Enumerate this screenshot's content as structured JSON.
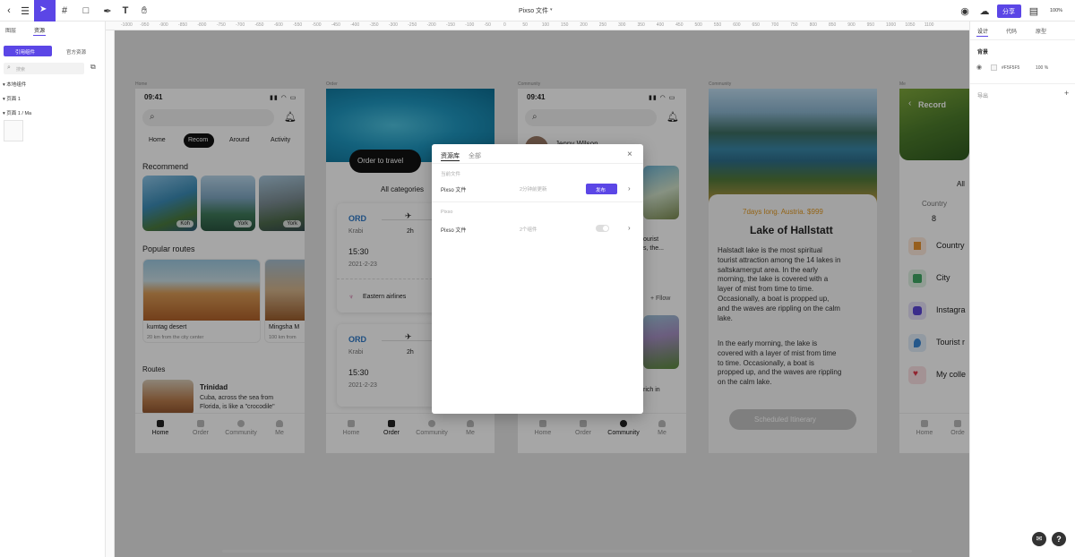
{
  "toolbar": {
    "doc_title": "Pixso 文件",
    "share_label": "分享",
    "zoom": "100%"
  },
  "left_panel": {
    "tabs": [
      "图层",
      "资源"
    ],
    "sub_tabs": [
      "引用组件",
      "官方资源"
    ],
    "search_placeholder": "搜索",
    "tree": [
      "本地组件",
      "页面 1",
      "页面 1 / Ma"
    ]
  },
  "right_panel": {
    "tabs": [
      "设计",
      "代码",
      "原型"
    ],
    "bg_label": "背景",
    "bg_hex": "#F5F5F5",
    "bg_opacity": "100 %",
    "export_label": "导出"
  },
  "ruler": {
    "ticks": [
      "-1000",
      "-950",
      "-900",
      "-850",
      "-800",
      "-750",
      "-700",
      "-650",
      "-600",
      "-550",
      "-500",
      "-450",
      "-400",
      "-350",
      "-300",
      "-250",
      "-200",
      "-150",
      "-100",
      "-50",
      "0",
      "50",
      "100",
      "150",
      "200",
      "250",
      "300",
      "350",
      "400",
      "450",
      "500",
      "550",
      "600",
      "650",
      "700",
      "750",
      "800",
      "850",
      "900",
      "950",
      "1000",
      "1050",
      "1100"
    ]
  },
  "frame_labels": {
    "home": "Home",
    "order": "Order",
    "community": "Community",
    "community2": "Community",
    "me": "Me"
  },
  "home": {
    "time": "09:41",
    "tabs": [
      "Home",
      "Recom",
      "Around",
      "Activity"
    ],
    "recommend_title": "Recommend",
    "rec_cards": [
      "Koh",
      "York",
      "York"
    ],
    "popular_title": "Popular routes",
    "routes": [
      {
        "name": "kumtag desert",
        "sub": "20 km from the city center"
      },
      {
        "name": "Mingsha M",
        "sub": "100 km from"
      }
    ],
    "routes_title": "Routes",
    "route_item": {
      "title": "Trinidad",
      "desc1": "Cuba, across the sea from",
      "desc2": "Florida, is like a \"crocodile\""
    },
    "nav": [
      "Home",
      "Order",
      "Community",
      "Me"
    ]
  },
  "order": {
    "cta": "Order to travel",
    "all_categories": "All categories",
    "tickets": [
      {
        "code": "ORD",
        "city": "Krabi",
        "dur": "2h",
        "time": "15:30",
        "date": "2021-2-23",
        "airline": "Eastern airlines"
      },
      {
        "code": "ORD",
        "city": "Krabi",
        "dur": "2h",
        "time": "15:30",
        "date": "2021-2-23"
      }
    ],
    "nav": [
      "Home",
      "Order",
      "Community",
      "Me"
    ]
  },
  "community": {
    "time": "09:41",
    "user": "Jenny Wilson",
    "snippets": [
      "ourist",
      "s, the...",
      "rich in"
    ],
    "follow": "+ Fllow",
    "nav": [
      "Home",
      "Order",
      "Community",
      "Me"
    ]
  },
  "detail": {
    "tagline": "7days long. Austria. $999",
    "title": "Lake of Hallstatt",
    "p1": [
      "Halstadt lake is the most spiritual",
      "tourist attraction among the 14 lakes in",
      "saltskamergut area. In the early",
      "morning, the lake is covered with a",
      "layer of mist from time to time.",
      "Occasionally, a boat is propped up,",
      "and the waves are rippling on the calm",
      "lake."
    ],
    "p2": [
      "In the early morning, the lake is",
      "covered with a layer of mist from time",
      "to time. Occasionally, a boat is",
      "propped up, and the waves are rippling",
      "on the calm lake."
    ],
    "button": "Scheduled Itinerary"
  },
  "me": {
    "record": "Record",
    "all": "All",
    "country_label": "Country",
    "country_value": "8",
    "items": [
      "Country",
      "City",
      "Instagra",
      "Tourist r",
      "My colle"
    ],
    "nav": [
      "Home",
      "Orde"
    ]
  },
  "modal": {
    "tabs": [
      "资源库",
      "全部"
    ],
    "section1": "当前文件",
    "row1_name": "Pixso 文件",
    "row1_meta": "2分钟前更新",
    "row1_button": "发布",
    "section2": "Pixso",
    "row2_name": "Pixso 文件",
    "row2_meta": "2个组件"
  }
}
